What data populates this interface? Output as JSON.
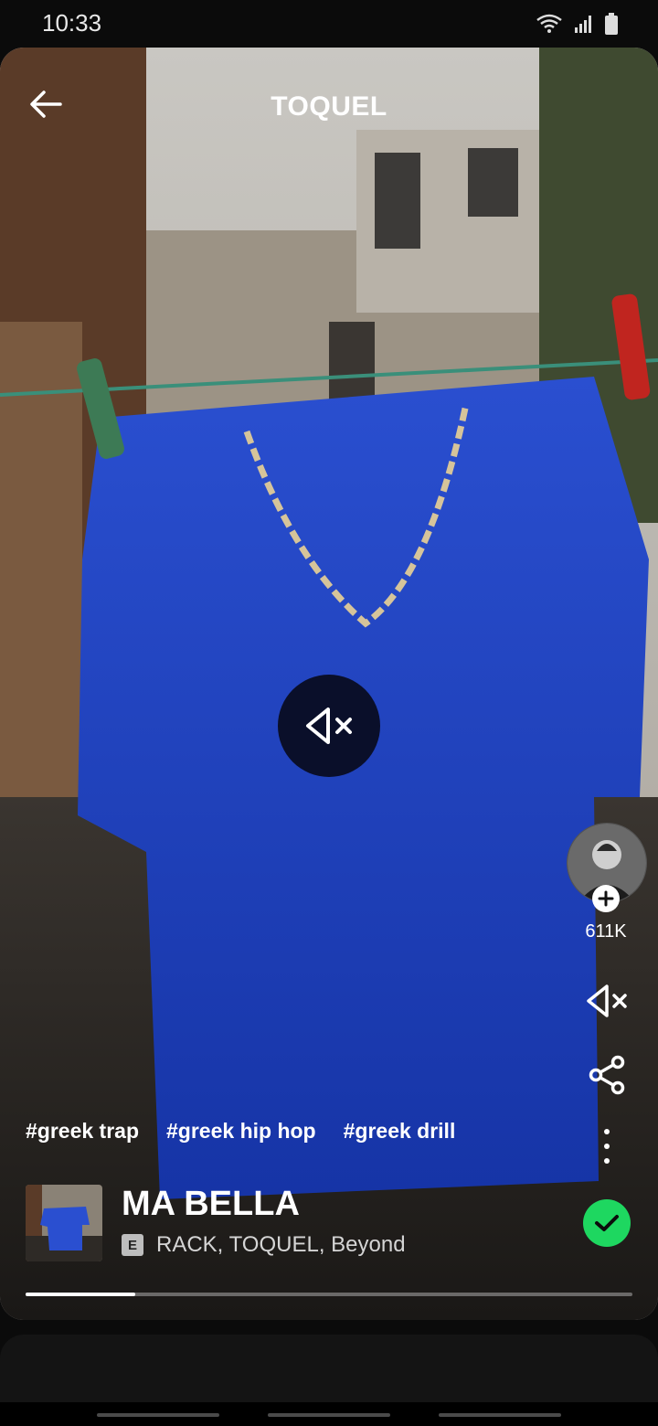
{
  "status": {
    "time": "10:33"
  },
  "header": {
    "title": "TOQUEL"
  },
  "side": {
    "followers": "611K"
  },
  "tags": [
    "#greek trap",
    "#greek hip hop",
    "#greek drill"
  ],
  "track": {
    "title": "MA BELLA",
    "explicit": "E",
    "artists": "RACK, TOQUEL, Beyond"
  },
  "progress": {
    "fraction": 0.18
  },
  "icons": [
    "back-arrow-icon",
    "mute-icon",
    "plus-icon",
    "share-icon",
    "more-vertical-icon",
    "check-icon",
    "wifi-icon",
    "signal-icon",
    "battery-icon"
  ],
  "colors": {
    "saved_green": "#1ed760",
    "shirt_blue": "#1b3bbf"
  }
}
